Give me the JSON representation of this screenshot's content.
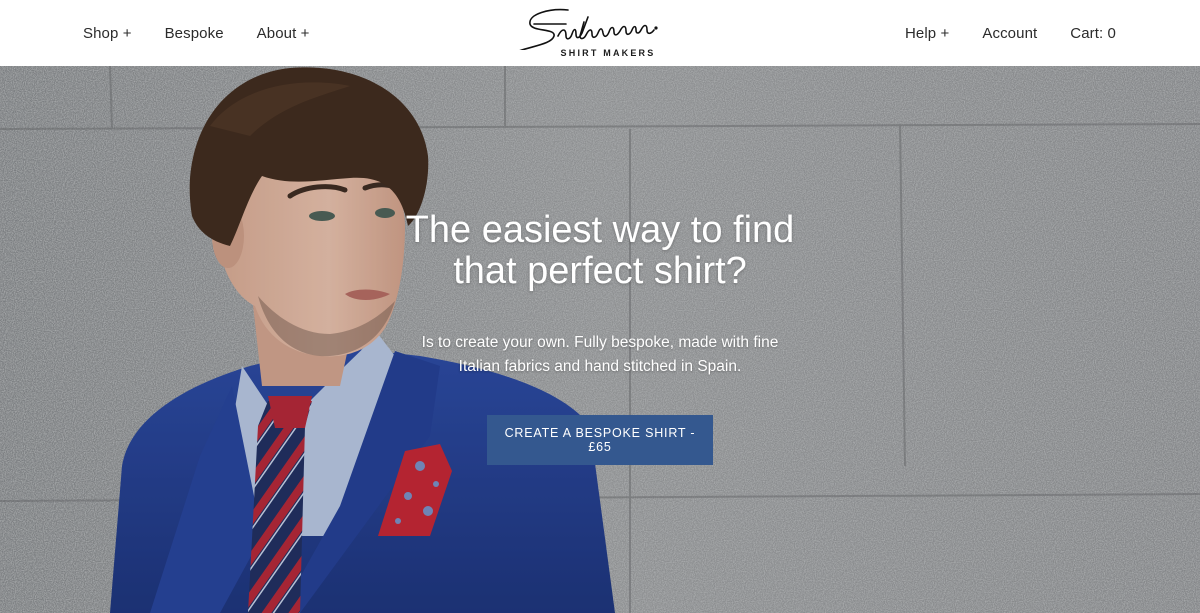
{
  "header": {
    "nav_left": [
      {
        "label": "Shop +"
      },
      {
        "label": "Bespoke"
      },
      {
        "label": "About +"
      }
    ],
    "logo": {
      "wordmark": "Santamaria",
      "tagline": "SHIRT MAKERS"
    },
    "nav_right": [
      {
        "label": "Help +"
      },
      {
        "label": "Account"
      },
      {
        "label": "Cart: 0"
      }
    ]
  },
  "hero": {
    "title_line1": "The easiest way to find",
    "title_line2": "that perfect shirt?",
    "subtitle": "Is to create your own. Fully bespoke, made with fine Italian fabrics and hand stitched in Spain.",
    "cta_label": "CREATE A BESPOKE SHIRT - £65"
  },
  "colors": {
    "cta_background": "#34588f",
    "header_background": "#ffffff",
    "hero_text": "#ffffff",
    "suit_blue": "#1e3c93"
  }
}
